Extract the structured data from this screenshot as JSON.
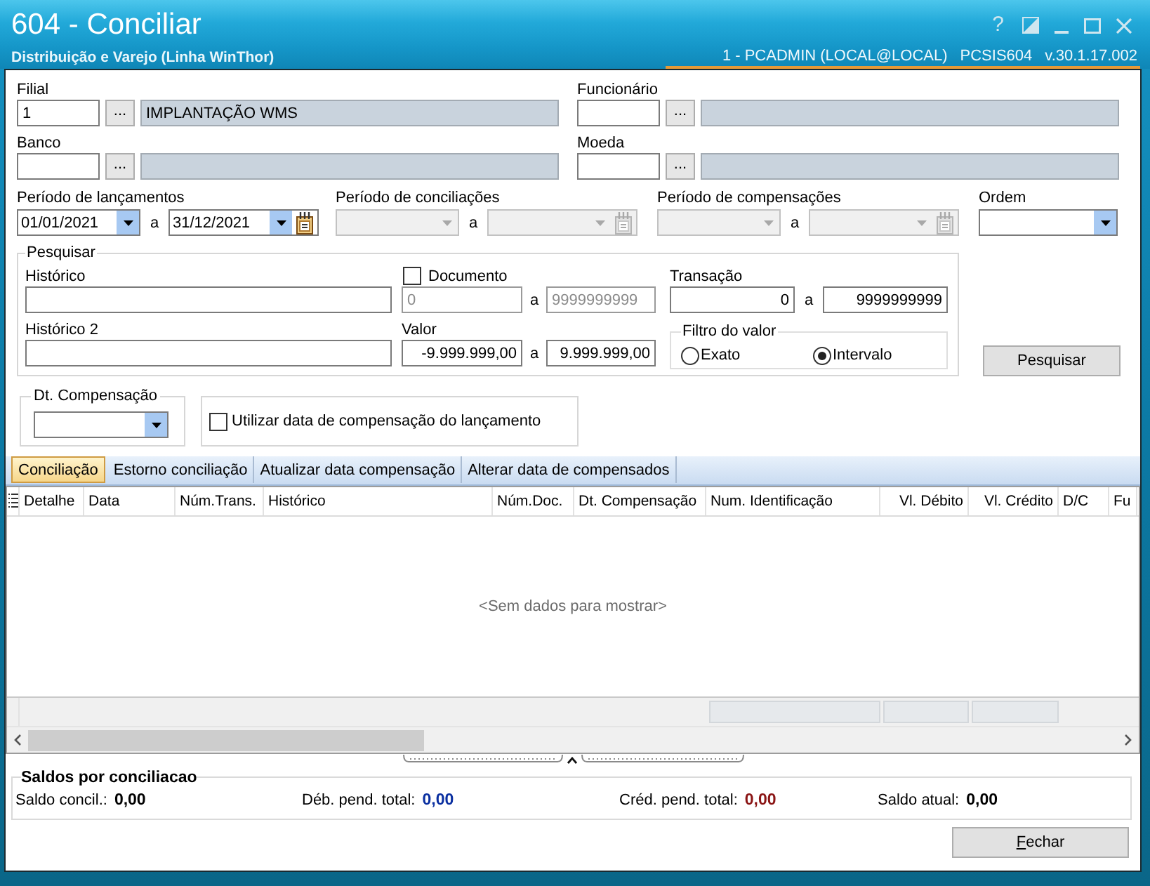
{
  "window": {
    "title": "604 - Conciliar",
    "subtitle": "Distribuição e Varejo (Linha WinThor)",
    "session": "1 - PCADMIN (LOCAL@LOCAL)",
    "program": "PCSIS604",
    "version": "v.30.1.17.002",
    "help": "?"
  },
  "lookups": [
    {
      "label": "Filial",
      "code": "1",
      "button": "...",
      "description": "IMPLANTAÇÃO WMS"
    },
    {
      "label": "Funcionário",
      "button": "..."
    },
    {
      "label": "Banco",
      "button": "..."
    },
    {
      "label": "Moeda",
      "button": "..."
    }
  ],
  "periods": [
    {
      "label": "Período de lançamentos",
      "from": "01/01/2021",
      "separator": "a",
      "to": "31/12/2021",
      "disabled": false
    },
    {
      "label": "Período de conciliações",
      "separator": "a",
      "disabled": true
    },
    {
      "label": "Período de compensações",
      "separator": "a",
      "disabled": true
    }
  ],
  "order": {
    "label": "Ordem"
  },
  "search": {
    "title": "Pesquisar",
    "historico": {
      "label": "Histórico"
    },
    "historico_2": {
      "label": "Histórico 2"
    },
    "documento": {
      "label": "Documento",
      "checked": false,
      "from": "0",
      "separator": "a",
      "to": "9999999999"
    },
    "valor": {
      "label": "Valor",
      "from": "-9.999.999,00",
      "separator": "a",
      "to": "9.999.999,00"
    },
    "transacao": {
      "label": "Transação",
      "from": "0",
      "separator": "a",
      "to": "9999999999"
    },
    "value_filter": {
      "title": "Filtro do valor",
      "options": [
        {
          "label": "Exato",
          "selected": false
        },
        {
          "label": "Intervalo",
          "selected": true
        }
      ]
    }
  },
  "search_button": {
    "label": "Pesquisar"
  },
  "compensation_date": {
    "title": "Dt. Compensação"
  },
  "use_compensation_date": {
    "label": "Utilizar data de compensação do lançamento",
    "checked": false
  },
  "tabs": [
    {
      "label": "Conciliação",
      "selected": true
    },
    {
      "label": "Estorno conciliação",
      "selected": false
    },
    {
      "label": "Atualizar data compensação",
      "selected": false
    },
    {
      "label": "Alterar data de compensados",
      "selected": false
    }
  ],
  "table": {
    "columns": [
      {
        "label": "Detalhe",
        "kind": "text"
      },
      {
        "label": "Data",
        "kind": "text"
      },
      {
        "label": "Núm.Trans.",
        "kind": "text"
      },
      {
        "label": "Histórico",
        "kind": "text"
      },
      {
        "label": "Núm.Doc.",
        "kind": "text"
      },
      {
        "label": "Dt. Compensação",
        "kind": "text"
      },
      {
        "label": "Num. Identificação",
        "kind": "text"
      },
      {
        "label": "Vl. Débito",
        "kind": "number"
      },
      {
        "label": "Vl. Crédito",
        "kind": "number"
      },
      {
        "label": "D/C",
        "kind": "text"
      },
      {
        "label": "Fu",
        "kind": "text"
      }
    ],
    "empty_text": "<Sem dados para mostrar>"
  },
  "balances": {
    "title": "Saldos por conciliacao",
    "items": [
      {
        "label": "Saldo concil.:",
        "value": "0,00",
        "color": "#000000"
      },
      {
        "label": "Déb. pend. total:",
        "value": "0,00",
        "color": "#0a2fa0"
      },
      {
        "label": "Créd. pend. total:",
        "value": "0,00",
        "color": "#8a1414"
      },
      {
        "label": "Saldo atual:",
        "value": "0,00",
        "color": "#000000"
      }
    ]
  },
  "buttons": [
    {
      "label": "Fechar"
    }
  ]
}
